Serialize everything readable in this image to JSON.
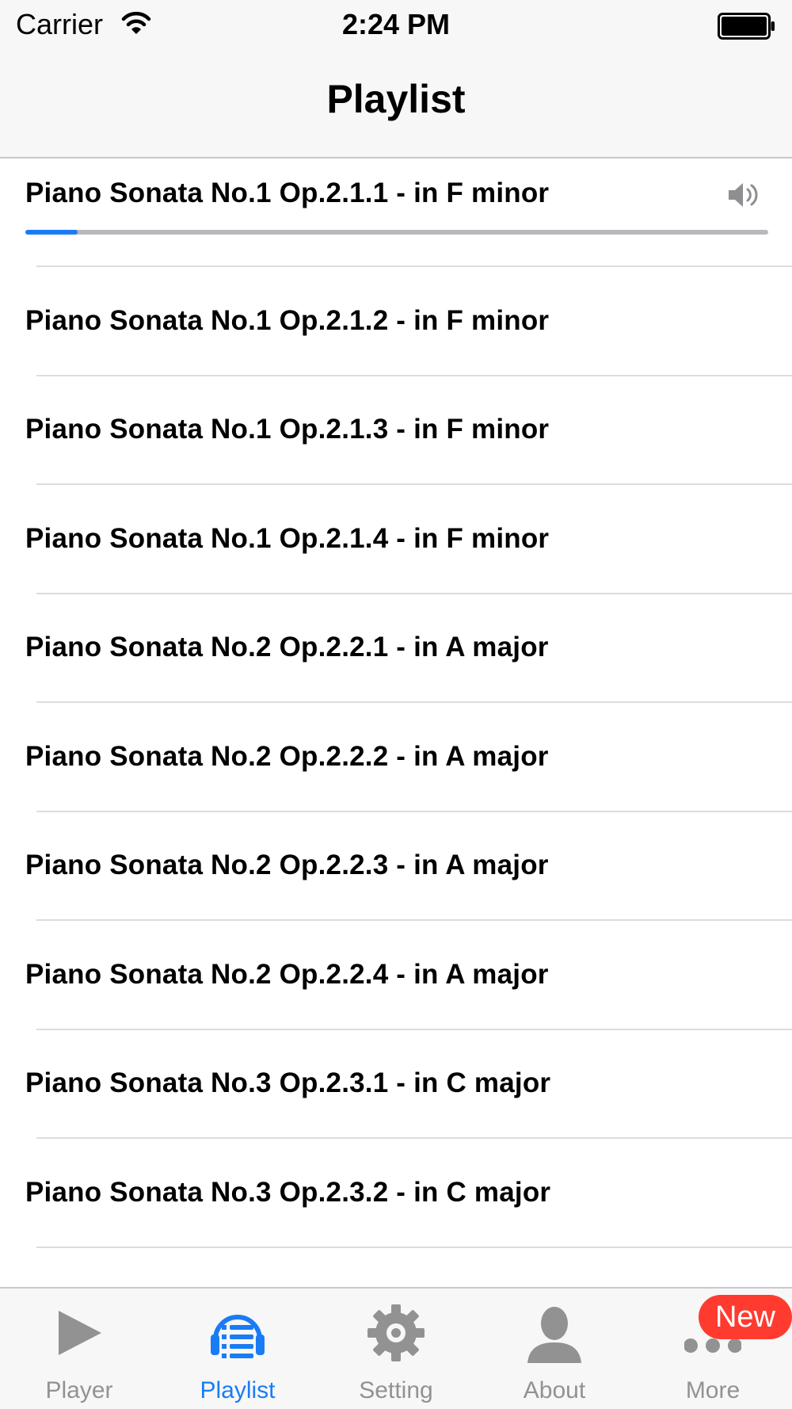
{
  "status_bar": {
    "carrier": "Carrier",
    "time": "2:24 PM"
  },
  "nav": {
    "title": "Playlist"
  },
  "playlist": {
    "now_playing_index": 0,
    "progress": 0.07,
    "items": [
      "Piano Sonata No.1 Op.2.1.1 - in F minor",
      "Piano Sonata No.1 Op.2.1.2 - in F minor",
      "Piano Sonata No.1 Op.2.1.3 - in F minor",
      "Piano Sonata No.1 Op.2.1.4 - in F minor",
      "Piano Sonata No.2 Op.2.2.1 - in A major",
      "Piano Sonata No.2 Op.2.2.2 - in A major",
      "Piano Sonata No.2 Op.2.2.3 - in A major",
      "Piano Sonata No.2 Op.2.2.4 - in A major",
      "Piano Sonata No.3 Op.2.3.1 - in C major",
      "Piano Sonata No.3 Op.2.3.2 - in C major"
    ]
  },
  "tab_bar": {
    "tabs": [
      {
        "label": "Player",
        "icon": "play-icon",
        "active": false
      },
      {
        "label": "Playlist",
        "icon": "playlist-icon",
        "active": true
      },
      {
        "label": "Setting",
        "icon": "gear-icon",
        "active": false
      },
      {
        "label": "About",
        "icon": "person-icon",
        "active": false
      },
      {
        "label": "More",
        "icon": "more-icon",
        "active": false
      }
    ],
    "more_badge": "New"
  },
  "colors": {
    "accent": "#1a7cf4",
    "inactive": "#929292",
    "badge": "#ff3b30",
    "bar_background": "#f7f7f7"
  }
}
